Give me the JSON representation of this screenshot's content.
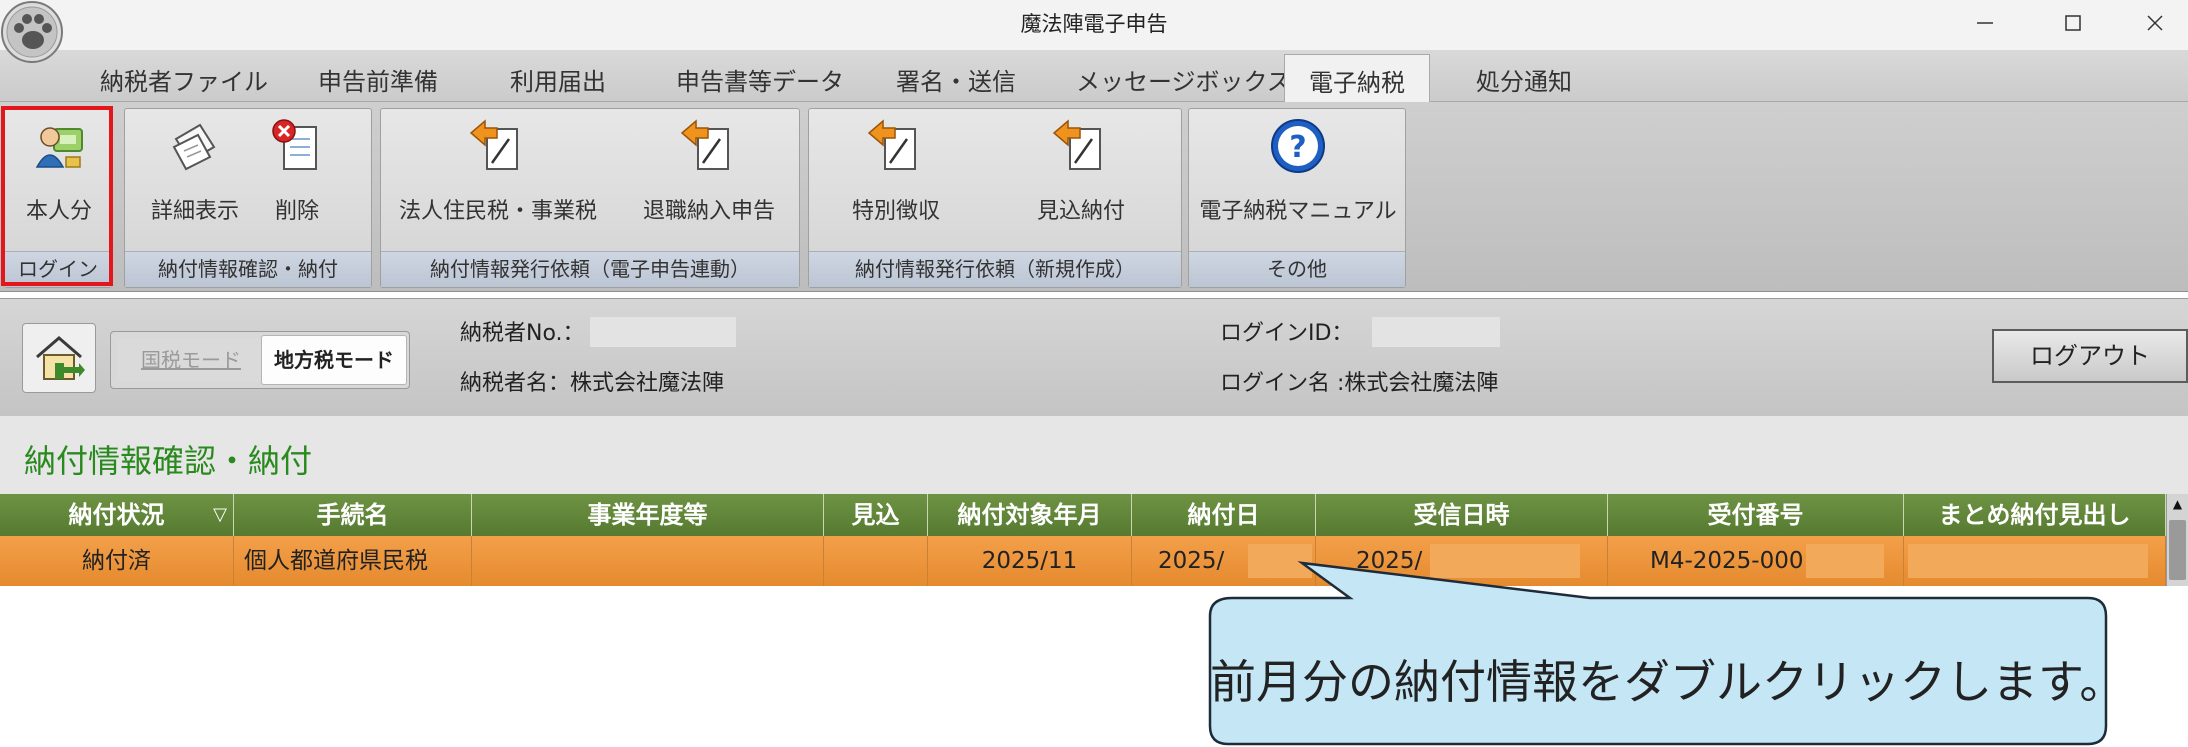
{
  "window": {
    "title": "魔法陣電子申告"
  },
  "menu": {
    "items": [
      "納税者ファイル",
      "申告前準備",
      "利用届出",
      "申告書等データ",
      "署名・送信",
      "メッセージボックス",
      "電子納税",
      "処分通知"
    ],
    "active_index": 6
  },
  "ribbon": {
    "groups": [
      {
        "caption": "ログイン",
        "buttons": [
          "本人分"
        ]
      },
      {
        "caption": "納付情報確認・納付",
        "buttons": [
          "詳細表示",
          "削除"
        ]
      },
      {
        "caption": "納付情報発行依頼（電子申告連動）",
        "buttons": [
          "法人住民税・事業税",
          "退職納入申告"
        ]
      },
      {
        "caption": "納付情報発行依頼（新規作成）",
        "buttons": [
          "特別徴収",
          "見込納付"
        ]
      },
      {
        "caption": "その他",
        "buttons": [
          "電子納税マニュアル"
        ]
      }
    ]
  },
  "infobar": {
    "mode_national": "国税モード",
    "mode_local": "地方税モード",
    "taxpayer_no_label": "納税者No.：",
    "taxpayer_name_label": "納税者名：株式会社魔法陣",
    "login_id_label": "ログインID：",
    "login_name_label": "ログイン名 :株式会社魔法陣",
    "logout": "ログアウト"
  },
  "section": {
    "title": "納付情報確認・納付"
  },
  "table": {
    "columns": [
      "納付状況",
      "手続名",
      "事業年度等",
      "見込",
      "納付対象年月",
      "納付日",
      "受信日時",
      "受付番号",
      "まとめ納付見出し"
    ],
    "rows": [
      [
        "納付済",
        "個人都道府県民税",
        "",
        "",
        "2025/11",
        "2025/",
        "2025/",
        "M4-2025-000",
        ""
      ]
    ]
  },
  "callout": {
    "text": "前月分の納付情報をダブルクリックします。"
  },
  "colors": {
    "accent_green": "#2a8a1f",
    "header_green": "#5f8539",
    "selected_row_orange": "#ec9139",
    "callout_fill": "#c5e6f5",
    "highlight_red": "#e3161c"
  }
}
